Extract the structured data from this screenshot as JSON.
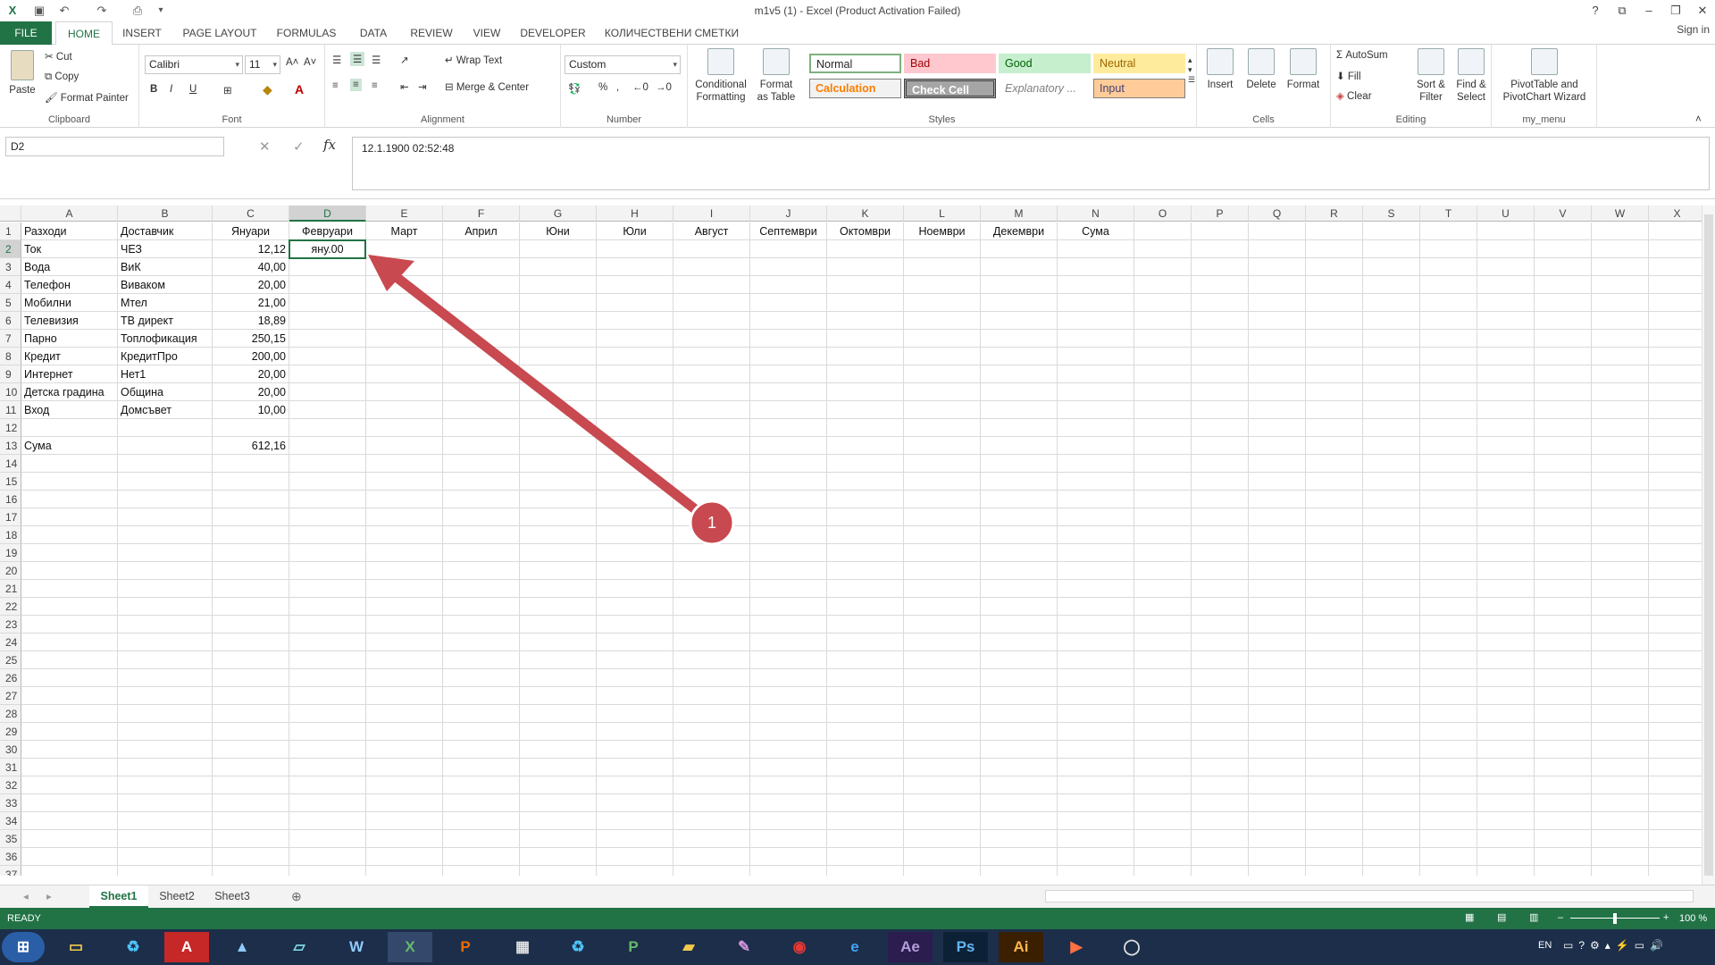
{
  "title": "m1v5 (1) - Excel (Product Activation Failed)",
  "tabs": [
    "FILE",
    "HOME",
    "INSERT",
    "PAGE LAYOUT",
    "FORMULAS",
    "DATA",
    "REVIEW",
    "VIEW",
    "DEVELOPER",
    "КОЛИЧЕСТВЕНИ СМЕТКИ"
  ],
  "signin": "Sign in",
  "ribbon": {
    "clipboard": {
      "paste": "Paste",
      "cut": "Cut",
      "copy": "Copy",
      "painter": "Format Painter",
      "label": "Clipboard"
    },
    "font": {
      "name": "Calibri",
      "size": "11",
      "bold": "B",
      "italic": "I",
      "underline": "U",
      "label": "Font"
    },
    "alignment": {
      "wrap": "Wrap Text",
      "merge": "Merge & Center",
      "label": "Alignment"
    },
    "number": {
      "format": "Custom",
      "percent": "%",
      "comma": ",",
      "label": "Number"
    },
    "styles": {
      "cond": "Conditional Formatting",
      "table": "Format as Table",
      "normal": "Normal",
      "bad": "Bad",
      "good": "Good",
      "neutral": "Neutral",
      "calculation": "Calculation",
      "check": "Check Cell",
      "explanatory": "Explanatory ...",
      "input": "Input",
      "label": "Styles"
    },
    "cells": {
      "insert": "Insert",
      "delete": "Delete",
      "format": "Format",
      "label": "Cells"
    },
    "editing": {
      "autosum": "AutoSum",
      "fill": "Fill",
      "clear": "Clear",
      "sort": "Sort & Filter",
      "find": "Find & Select",
      "label": "Editing"
    },
    "mymenu": {
      "pivot": "PivotTable and PivotChart Wizard",
      "label": "my_menu"
    }
  },
  "namebox": "D2",
  "formula": "12.1.1900  02:52:48",
  "columns": [
    "A",
    "B",
    "C",
    "D",
    "E",
    "F",
    "G",
    "H",
    "I",
    "J",
    "K",
    "L",
    "M",
    "N",
    "O",
    "P",
    "Q",
    "R",
    "S",
    "T",
    "U",
    "V",
    "W",
    "X"
  ],
  "rows": [
    [
      "Разходи",
      "Доставчик",
      "Януари",
      "Февруари",
      "Март",
      "Април",
      "Юни",
      "Юли",
      "Август",
      "Септември",
      "Октомври",
      "Ноември",
      "Декември",
      "Сума"
    ],
    [
      "Ток",
      "ЧЕЗ",
      "12,12",
      "яну.00"
    ],
    [
      "Вода",
      "ВиК",
      "40,00"
    ],
    [
      "Телефон",
      "Виваком",
      "20,00"
    ],
    [
      "Мобилни",
      "Мтел",
      "21,00"
    ],
    [
      "Телевизия",
      "ТВ директ",
      "18,89"
    ],
    [
      "Парно",
      "Топлофикация",
      "250,15"
    ],
    [
      "Кредит",
      "КредитПро",
      "200,00"
    ],
    [
      "Интернет",
      "Нет1",
      "20,00"
    ],
    [
      "Детска градина",
      "Община",
      "20,00"
    ],
    [
      "Вход",
      "Домсъвет",
      "10,00"
    ],
    [],
    [
      "Сума",
      "",
      "612,16"
    ]
  ],
  "row_count": 37,
  "sheets": [
    "Sheet1",
    "Sheet2",
    "Sheet3"
  ],
  "status": "READY",
  "zoom": "100 %",
  "annotation": "1",
  "tray": {
    "lang": "EN"
  }
}
